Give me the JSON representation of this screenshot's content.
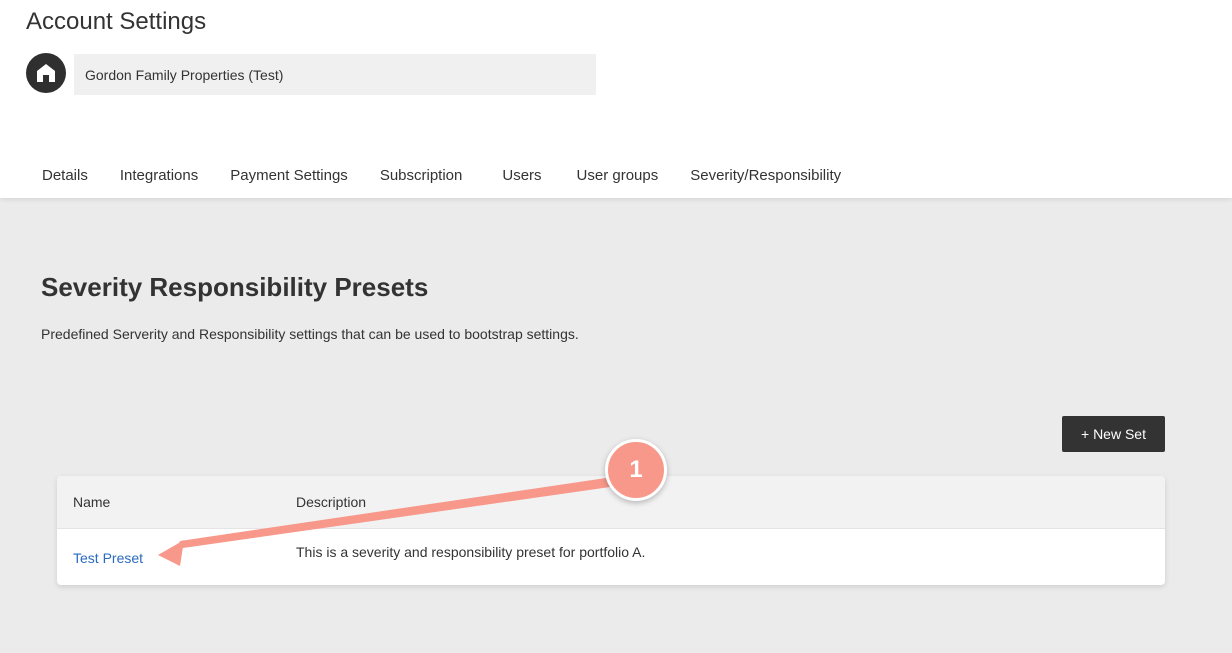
{
  "header": {
    "title": "Account Settings",
    "account_name": "Gordon Family Properties (Test)",
    "logo_icon": "home-logo-icon"
  },
  "tabs": [
    {
      "label": "Details"
    },
    {
      "label": "Integrations"
    },
    {
      "label": "Payment Settings"
    },
    {
      "label": "Subscription"
    },
    {
      "label": "Users"
    },
    {
      "label": "User groups"
    },
    {
      "label": "Severity/Responsibility"
    }
  ],
  "main": {
    "section_title": "Severity Responsibility Presets",
    "section_description": "Predefined Serverity and Responsibility settings that can be used to bootstrap settings.",
    "new_set_label": "+ New Set",
    "table": {
      "columns": [
        "Name",
        "Description"
      ],
      "rows": [
        {
          "name": "Test Preset",
          "description": "This is a severity and responsibility preset for portfolio A."
        }
      ]
    }
  },
  "annotation": {
    "step_number": "1",
    "color": "#f7988a"
  },
  "colors": {
    "link": "#2a6ac0",
    "button_bg": "#333333",
    "page_bg": "#ebebeb"
  }
}
